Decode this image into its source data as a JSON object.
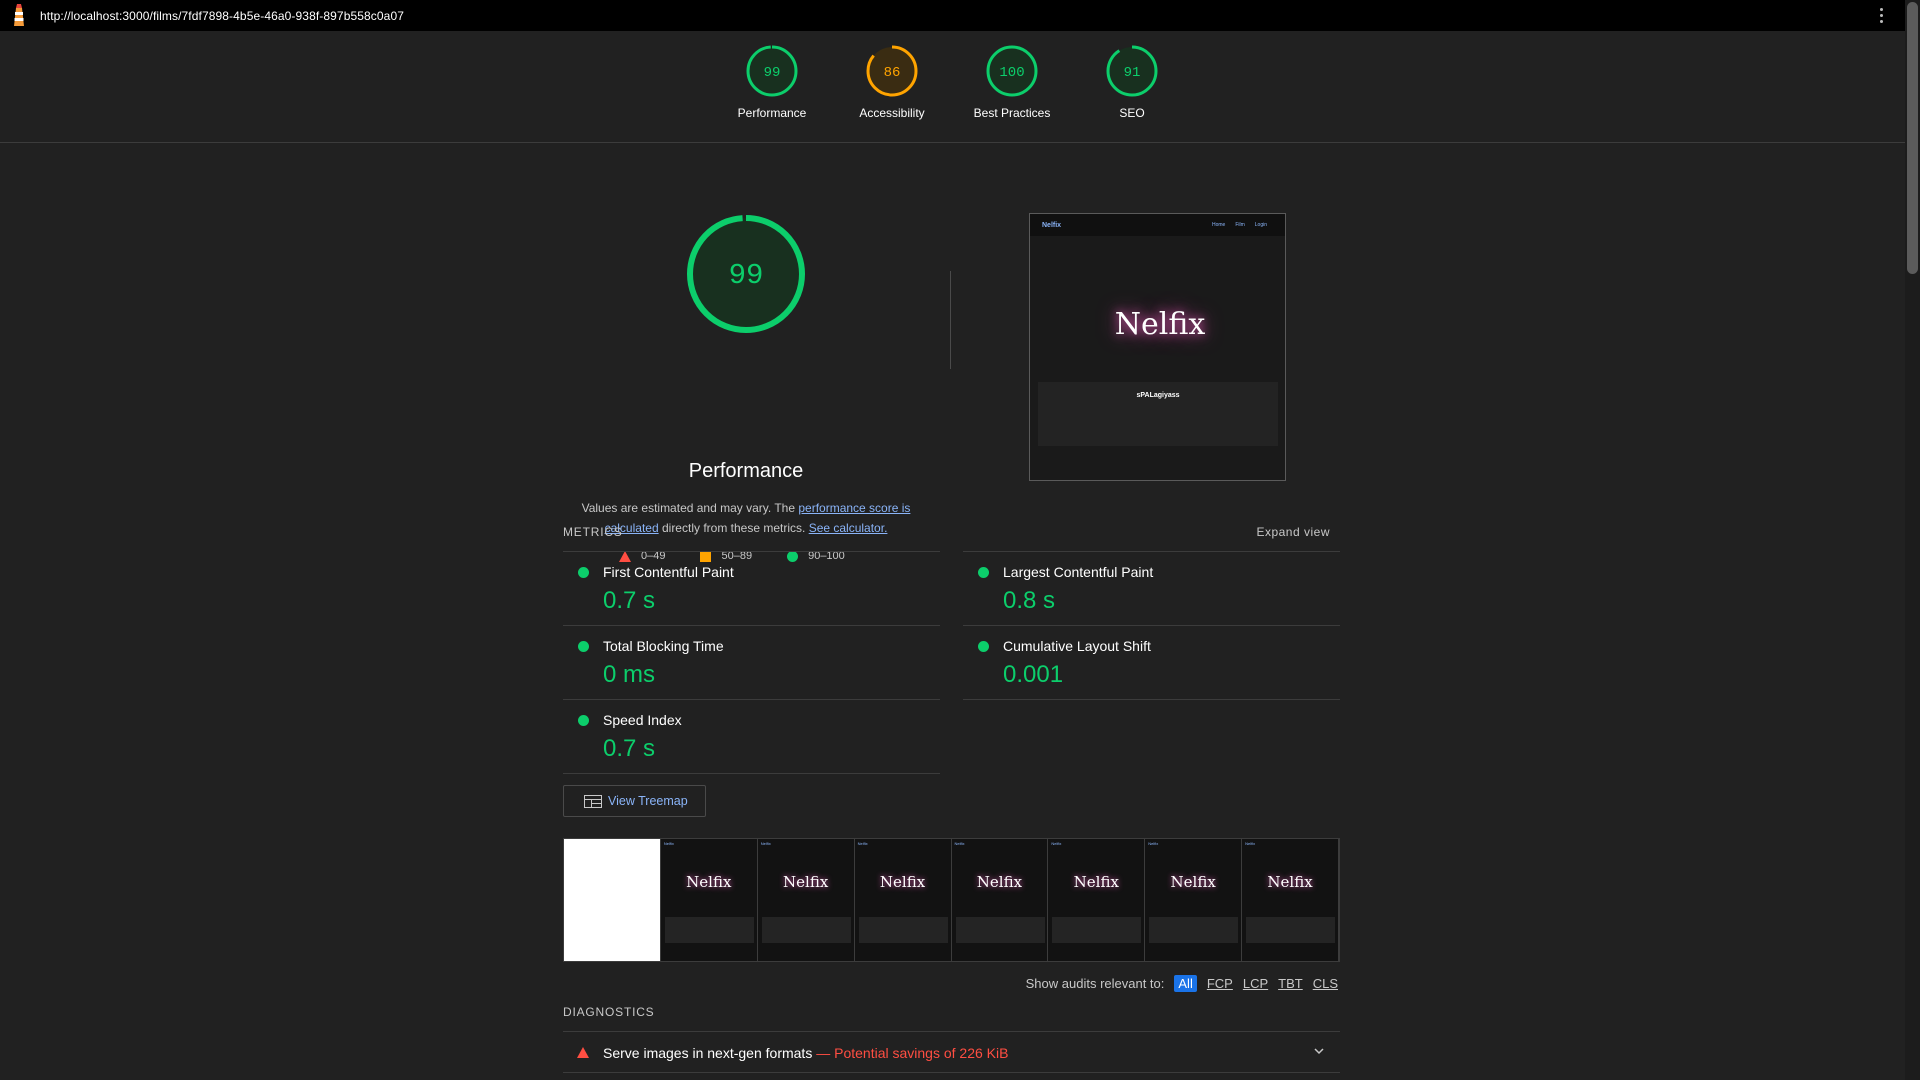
{
  "browser": {
    "url": "http://localhost:3000/films/7fdf7898-4b5e-46a0-938f-897b558c0a07"
  },
  "summary_gauges": [
    {
      "label": "Performance",
      "score": "99",
      "color": "#0cce6b"
    },
    {
      "label": "Accessibility",
      "score": "86",
      "color": "#ffa400"
    },
    {
      "label": "Best Practices",
      "score": "100",
      "color": "#0cce6b"
    },
    {
      "label": "SEO",
      "score": "91",
      "color": "#0cce6b"
    }
  ],
  "performance": {
    "score": "99",
    "title": "Performance",
    "desc_prefix": "Values are estimated and may vary. The ",
    "desc_link1": "performance score is calculated",
    "desc_middle": " directly from these metrics. ",
    "desc_link2": "See calculator.",
    "legend": {
      "fail": "0–49",
      "average": "50–89",
      "pass": "90–100"
    }
  },
  "screenshot": {
    "brand": "Nelfix",
    "links": [
      "Home",
      "Film",
      "Login"
    ],
    "logo": "Nelfix",
    "title": "sPALagiyass"
  },
  "metrics": {
    "heading": "METRICS",
    "expand_label": "Expand view",
    "items": [
      {
        "name": "First Contentful Paint",
        "value": "0.7 s"
      },
      {
        "name": "Largest Contentful Paint",
        "value": "0.8 s"
      },
      {
        "name": "Total Blocking Time",
        "value": "0 ms"
      },
      {
        "name": "Cumulative Layout Shift",
        "value": "0.001"
      },
      {
        "name": "Speed Index",
        "value": "0.7 s"
      }
    ]
  },
  "treemap_label": "View Treemap",
  "filmstrip": {
    "brand": "Nelfix",
    "logo": "Nelfix"
  },
  "audits_filter": {
    "label": "Show audits relevant to:",
    "options": [
      "All",
      "FCP",
      "LCP",
      "TBT",
      "CLS"
    ],
    "active": "All"
  },
  "diagnostics": {
    "heading": "DIAGNOSTICS",
    "items": [
      {
        "title": "Serve images in next-gen formats",
        "savings": " — Potential savings of 226 KiB"
      }
    ]
  },
  "colors": {
    "pass": "#0cce6b",
    "average": "#ffa400",
    "fail": "#ff4e42",
    "link": "#8ab4f8"
  }
}
